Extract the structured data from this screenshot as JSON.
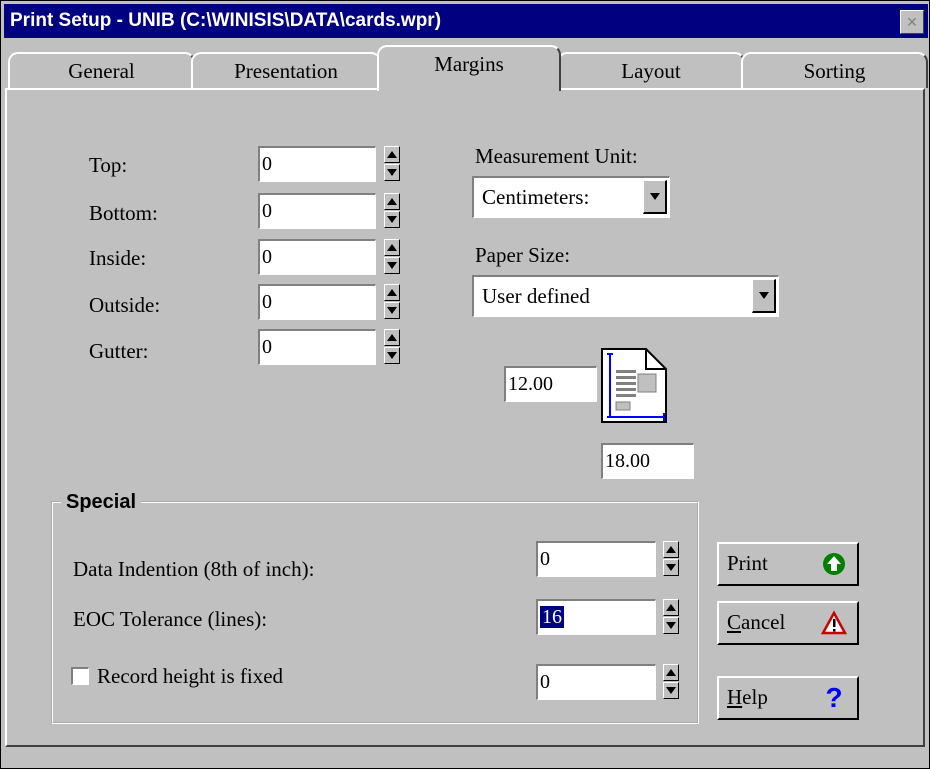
{
  "window": {
    "title": "Print Setup - UNIB (C:\\WINISIS\\DATA\\cards.wpr)",
    "close_glyph": "×"
  },
  "tabs": [
    {
      "label": "General"
    },
    {
      "label": "Presentation"
    },
    {
      "label": "Margins"
    },
    {
      "label": "Layout"
    },
    {
      "label": "Sorting"
    }
  ],
  "active_tab": "Margins",
  "margins": {
    "top": {
      "label": "Top:",
      "value": "0"
    },
    "bottom": {
      "label": "Bottom:",
      "value": "0"
    },
    "inside": {
      "label": "Inside:",
      "value": "0"
    },
    "outside": {
      "label": "Outside:",
      "value": "0"
    },
    "gutter": {
      "label": "Gutter:",
      "value": "0"
    }
  },
  "measurement": {
    "label": "Measurement Unit:",
    "value": "Centimeters:"
  },
  "paper": {
    "label": "Paper Size:",
    "value": "User defined",
    "width": "12.00",
    "height": "18.00"
  },
  "special": {
    "title": "Special",
    "data_indention": {
      "label": "Data Indention (8th of inch):",
      "value": "0"
    },
    "eoc_tolerance": {
      "label": "EOC Tolerance (lines):",
      "value": "16"
    },
    "record_height": {
      "label": "Record height is fixed",
      "checked": false,
      "value": "0"
    }
  },
  "buttons": {
    "print": {
      "label": "Print",
      "icon": "green-up-arrow-icon"
    },
    "cancel": {
      "mnemonic": "C",
      "rest": "ancel",
      "icon": "warning-icon"
    },
    "help": {
      "mnemonic": "H",
      "rest": "elp",
      "icon": "question-mark-icon",
      "glyph": "?"
    }
  },
  "colors": {
    "title_bar": "#000080",
    "face": "#c0c0c0",
    "print_icon": "#008000",
    "cancel_icon": "#cc0000",
    "help_icon": "#0000ff"
  }
}
